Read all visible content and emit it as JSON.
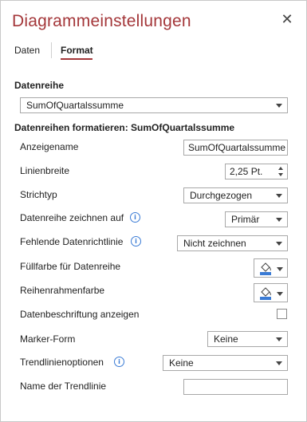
{
  "pane": {
    "title": "Diagrammeinstellungen",
    "close_symbol": "✕",
    "tabs": [
      {
        "label": "Daten",
        "active": false
      },
      {
        "label": "Format",
        "active": true
      }
    ]
  },
  "section_series": {
    "heading": "Datenreihe",
    "selected": "SumOfQuartalssumme"
  },
  "section_format": {
    "heading": "Datenreihen formatieren: SumOfQuartalssumme",
    "display_name": {
      "label": "Anzeigename",
      "value": "SumOfQuartalssumme"
    },
    "line_width": {
      "label": "Linienbreite",
      "value": "2,25 Pt."
    },
    "dash_type": {
      "label": "Strichtyp",
      "value": "Durchgezogen"
    },
    "plot_on": {
      "label": "Datenreihe zeichnen auf",
      "value": "Primär"
    },
    "missing_data": {
      "label": "Fehlende Datenrichtlinie",
      "value": "Nicht zeichnen"
    },
    "fill_color": {
      "label": "Füllfarbe für Datenreihe",
      "icon": "paint-bucket-icon"
    },
    "border_color": {
      "label": "Reihenrahmenfarbe",
      "icon": "paint-bucket-icon"
    },
    "data_labels": {
      "label": "Datenbeschriftung anzeigen",
      "checked": false
    },
    "marker_shape": {
      "label": "Marker-Form",
      "value": "Keine"
    },
    "trendline": {
      "label": "Trendlinienoptionen",
      "value": "Keine"
    },
    "trendline_name": {
      "label": "Name der Trendlinie",
      "value": ""
    }
  },
  "colors": {
    "accent": "#a4373a",
    "info_icon": "#3a7bd5"
  }
}
